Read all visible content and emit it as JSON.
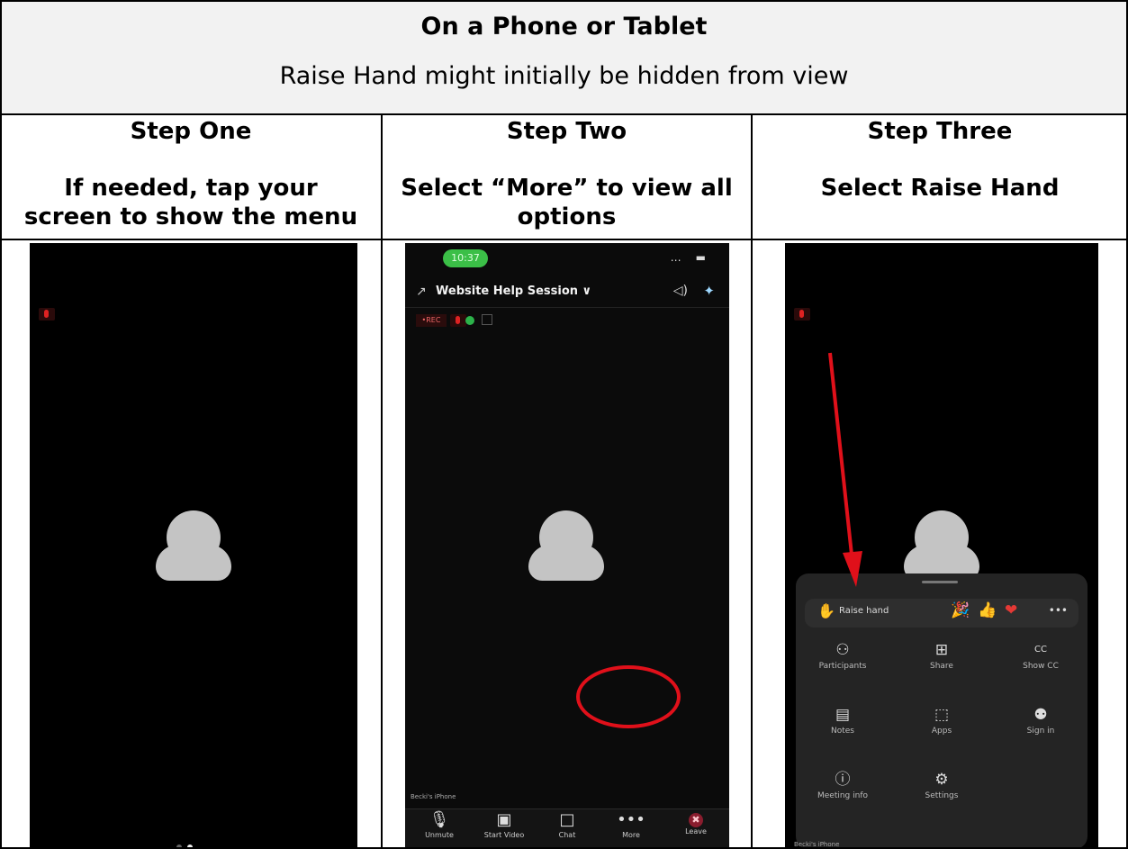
{
  "header": {
    "title": "On a Phone or Tablet",
    "subtitle": "Raise Hand might initially be hidden from view"
  },
  "steps": [
    {
      "title": "Step One",
      "line1": "If needed, tap your",
      "line2": "screen to show the menu"
    },
    {
      "title": "Step Two",
      "line1": "Select “More” to view all",
      "line2": "options"
    },
    {
      "title": "Step Three",
      "line1": "Select Raise Hand",
      "line2": ""
    }
  ],
  "phone_two": {
    "time": "10:37",
    "status_icons": "… ▬",
    "session_title": "Website Help Session ∨",
    "rec_label": "•REC",
    "name_tag": "Becki's iPhone",
    "toolbar": [
      {
        "icon": "&#127897;",
        "label": "Unmute"
      },
      {
        "icon": "▣",
        "label": "Start Video"
      },
      {
        "icon": "□",
        "label": "Chat"
      },
      {
        "icon": "•••",
        "label": "More"
      },
      {
        "icon": "✖",
        "label": "Leave"
      }
    ]
  },
  "phone_three": {
    "raise_hand_label": "Raise hand",
    "more_reactions": "•••",
    "menu_items": [
      {
        "icon": "⚇",
        "label": "Participants"
      },
      {
        "icon": "⊞",
        "label": "Share"
      },
      {
        "icon": "CC",
        "label": "Show CC"
      },
      {
        "icon": "▤",
        "label": "Notes"
      },
      {
        "icon": "⬚",
        "label": "Apps"
      },
      {
        "icon": "⚉",
        "label": "Sign in"
      },
      {
        "icon": "ⓘ",
        "label": "Meeting info"
      },
      {
        "icon": "⚙",
        "label": "Settings"
      }
    ],
    "name_tag": "Becki's iPhone"
  },
  "colors": {
    "highlight_red": "#e0101a",
    "header_bg": "#f2f2f2",
    "time_pill": "#3bbf47"
  }
}
